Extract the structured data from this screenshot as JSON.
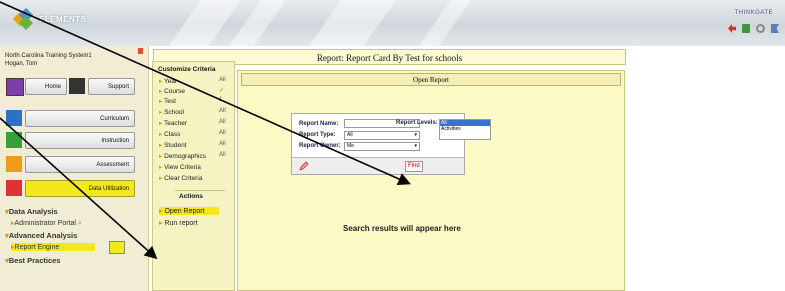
{
  "app": {
    "logo_text": "ELEMENTS",
    "vendor_text": "THINKGATE"
  },
  "user": {
    "org": "North Carolina Training System1",
    "name": "Hogan, Tom"
  },
  "quick_buttons": {
    "home": "Home",
    "support": "Support"
  },
  "modules": [
    "Curriculum",
    "Instruction",
    "Assessment",
    "Data Utilization"
  ],
  "nav": {
    "data_analysis": "Data Analysis",
    "administrator_portal": "Administrator Portal",
    "advanced_analysis": "Advanced Analysis",
    "report_engine": "Report Engine",
    "best_practices": "Best Practices"
  },
  "page_title": "Report: Report Card By Test for schools",
  "criteria": {
    "title": "Customize Criteria",
    "rows": [
      {
        "label": "Year",
        "value": "All"
      },
      {
        "label": "Course",
        "value": "✓"
      },
      {
        "label": "Test",
        "value": "1"
      },
      {
        "label": "School",
        "value": "All"
      },
      {
        "label": "Teacher",
        "value": "All"
      },
      {
        "label": "Class",
        "value": "All"
      },
      {
        "label": "Student",
        "value": "All"
      },
      {
        "label": "Demographics",
        "value": "All"
      },
      {
        "label": "View Criteria",
        "value": ""
      },
      {
        "label": "Clear Criteria",
        "value": ""
      }
    ]
  },
  "actions": {
    "title": "Actions",
    "open_report": "Open Report",
    "run_report": "Run report"
  },
  "open_report_panel": {
    "header": "Open Report",
    "report_name_label": "Report Name:",
    "report_name_value": "",
    "report_type_label": "Report Type:",
    "report_type_value": "All",
    "report_owner_label": "Report Owner:",
    "report_owner_value": "Me",
    "report_levels_label": "Report Levels:",
    "report_levels_options": [
      "All",
      "Activities"
    ],
    "find_button": "Find",
    "search_message": "Search results will appear here"
  },
  "colors": {
    "accent_yellow": "#f3e81b",
    "sidebar_bg": "#f1ecd4",
    "panel_bg": "#fbf9c4",
    "highlight_blue": "#3b6fd0"
  }
}
